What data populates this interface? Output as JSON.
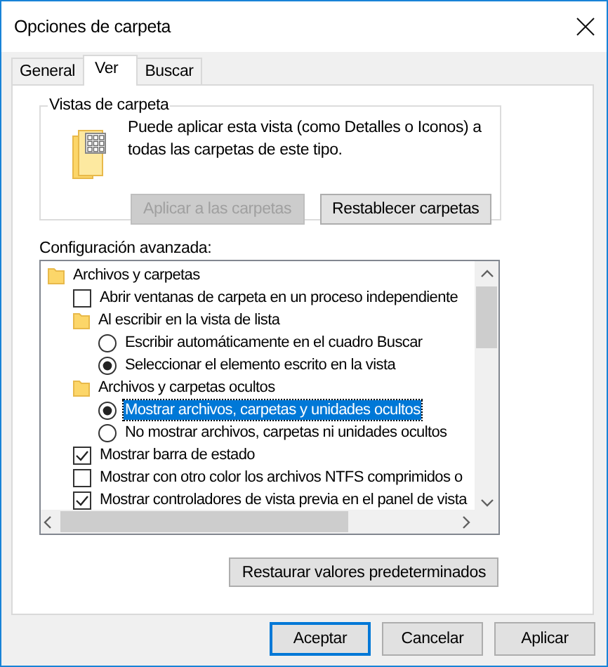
{
  "window": {
    "title": "Opciones de carpeta"
  },
  "tabs": [
    {
      "label": "General",
      "selected": false
    },
    {
      "label": "Ver",
      "selected": true
    },
    {
      "label": "Buscar",
      "selected": false
    }
  ],
  "folder_views": {
    "title": "Vistas de carpeta",
    "description": "Puede aplicar esta vista (como Detalles o Iconos) a todas las carpetas de este tipo.",
    "buttons": [
      {
        "label": "Aplicar a las carpetas",
        "disabled": true
      },
      {
        "label": "Restablecer carpetas",
        "disabled": false
      }
    ]
  },
  "advanced": {
    "label": "Configuración avanzada:",
    "items": [
      {
        "kind": "folder",
        "label": "Archivos y carpetas",
        "selected": false,
        "children": [
          {
            "kind": "checkbox",
            "label": "Abrir ventanas de carpeta  en un proceso independiente",
            "checked": false,
            "selected": false
          },
          {
            "kind": "folder",
            "label": "Al escribir en la vista de lista",
            "selected": false,
            "children": [
              {
                "kind": "radio",
                "label": "Escribir automáticamente en el cuadro Buscar",
                "checked": false,
                "selected": false
              },
              {
                "kind": "radio",
                "label": "Seleccionar el elemento escrito en la vista",
                "checked": true,
                "selected": false
              }
            ]
          },
          {
            "kind": "folder",
            "label": "Archivos y carpetas ocultos",
            "selected": false,
            "children": [
              {
                "kind": "radio",
                "label": "Mostrar archivos, carpetas y unidades ocultos",
                "checked": true,
                "selected": true
              },
              {
                "kind": "radio",
                "label": "No mostrar archivos, carpetas ni unidades ocultos",
                "checked": false,
                "selected": false
              }
            ]
          },
          {
            "kind": "checkbox",
            "label": "Mostrar barra de estado",
            "checked": true,
            "selected": false
          },
          {
            "kind": "checkbox",
            "label": "Mostrar con otro color los archivos NTFS comprimidos o",
            "checked": false,
            "selected": false
          },
          {
            "kind": "checkbox",
            "label": "Mostrar controladores de vista previa en el panel de vista",
            "checked": true,
            "selected": false
          }
        ]
      }
    ],
    "restore_button": "Restaurar valores predeterminados"
  },
  "buttons": [
    {
      "label": "Aceptar",
      "default": true
    },
    {
      "label": "Cancelar",
      "default": false
    },
    {
      "label": "Aplicar",
      "default": false
    }
  ]
}
